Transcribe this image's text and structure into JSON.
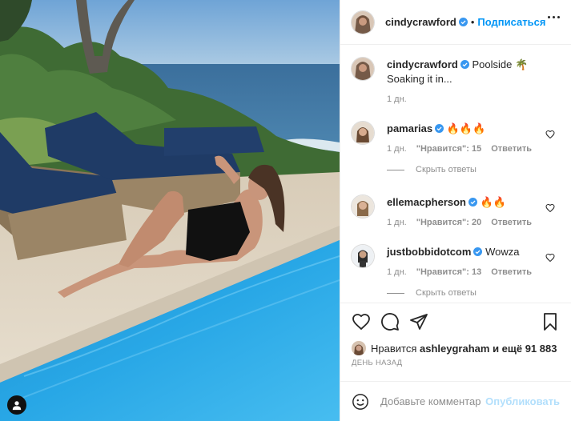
{
  "post": {
    "author": "cindycrawford",
    "separator": "•",
    "follow_label": "Подписаться",
    "caption_text": "Poolside 🌴 Soaking it in...",
    "caption_time": "1 дн."
  },
  "comments": [
    {
      "username": "pamarias",
      "text": "🔥🔥🔥",
      "time": "1 дн.",
      "likes": "\"Нравится\": 15",
      "reply_label": "Ответить",
      "hide_replies_label": "Скрыть ответы"
    },
    {
      "username": "ellemacpherson",
      "text": "🔥🔥",
      "time": "1 дн.",
      "likes": "\"Нравится\": 20",
      "reply_label": "Ответить"
    },
    {
      "username": "justbobbidotcom",
      "text": "Wowza",
      "time": "1 дн.",
      "likes": "\"Нравится\": 13",
      "reply_label": "Ответить",
      "hide_replies_label": "Скрыть ответы"
    }
  ],
  "likes_line": {
    "prefix": "Нравится",
    "user": "ashleygraham",
    "suffix": "и ещё 91 883"
  },
  "date_label": "ДЕНЬ НАЗАД",
  "comment_box": {
    "placeholder": "Добавьте комментарий...",
    "post_label": "Опубликовать"
  },
  "icons": {
    "verified": "verified-badge-icon",
    "more": "more-options-icon",
    "heart": "heart-icon",
    "comment": "comment-icon",
    "share": "share-icon",
    "save": "bookmark-icon",
    "emoji": "emoji-icon",
    "user_tag": "user-tag-icon"
  },
  "colors": {
    "accent": "#0095f6",
    "accent_disabled": "#b2dffc",
    "verified": "#3897f0",
    "muted": "#8e8e8e"
  }
}
